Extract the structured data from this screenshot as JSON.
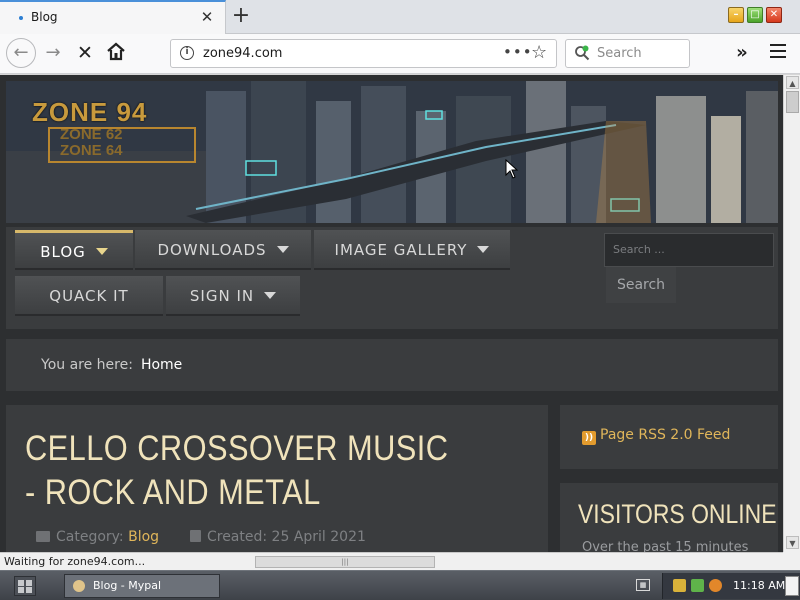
{
  "browser": {
    "tab_title": "Blog",
    "new_tab_symbol": "+",
    "url": "zone94.com",
    "url_more": "•••",
    "search_placeholder": "Search",
    "overflow_symbol": "»",
    "status_text": "Waiting for zone94.com..."
  },
  "site": {
    "logo_main": "ZONE 94",
    "logo_sub_1": "ZONE 62",
    "logo_sub_2": "ZONE 64",
    "menu": [
      {
        "label": "BLOG",
        "has_caret": true,
        "active": true
      },
      {
        "label": "DOWNLOADS",
        "has_caret": true,
        "active": false
      },
      {
        "label": "IMAGE GALLERY",
        "has_caret": true,
        "active": false
      },
      {
        "label": "QUACK IT",
        "has_caret": false,
        "active": false
      },
      {
        "label": "SIGN IN",
        "has_caret": true,
        "active": false
      }
    ],
    "search_placeholder": "Search ...",
    "search_button": "Search",
    "breadcrumb_prefix": "You are here:",
    "breadcrumb_current": "Home"
  },
  "article": {
    "title": "CELLO CROSSOVER MUSIC - ROCK AND METAL",
    "category_label": "Category:",
    "category_value": "Blog",
    "created_label": "Created: 25 April 2021"
  },
  "sidebar": {
    "rss_label": "Page RSS 2.0 Feed",
    "visitors_title": "VISITORS ONLINE",
    "visitors_sub": "Over the past 15 minutes"
  },
  "taskbar": {
    "window_label": "Blog - Mypal",
    "clock": "11:18 AM"
  },
  "colors": {
    "accent_gold": "#e0b65a",
    "title_cream": "#f0e3bb",
    "panel_dark": "#3a3c3e"
  }
}
